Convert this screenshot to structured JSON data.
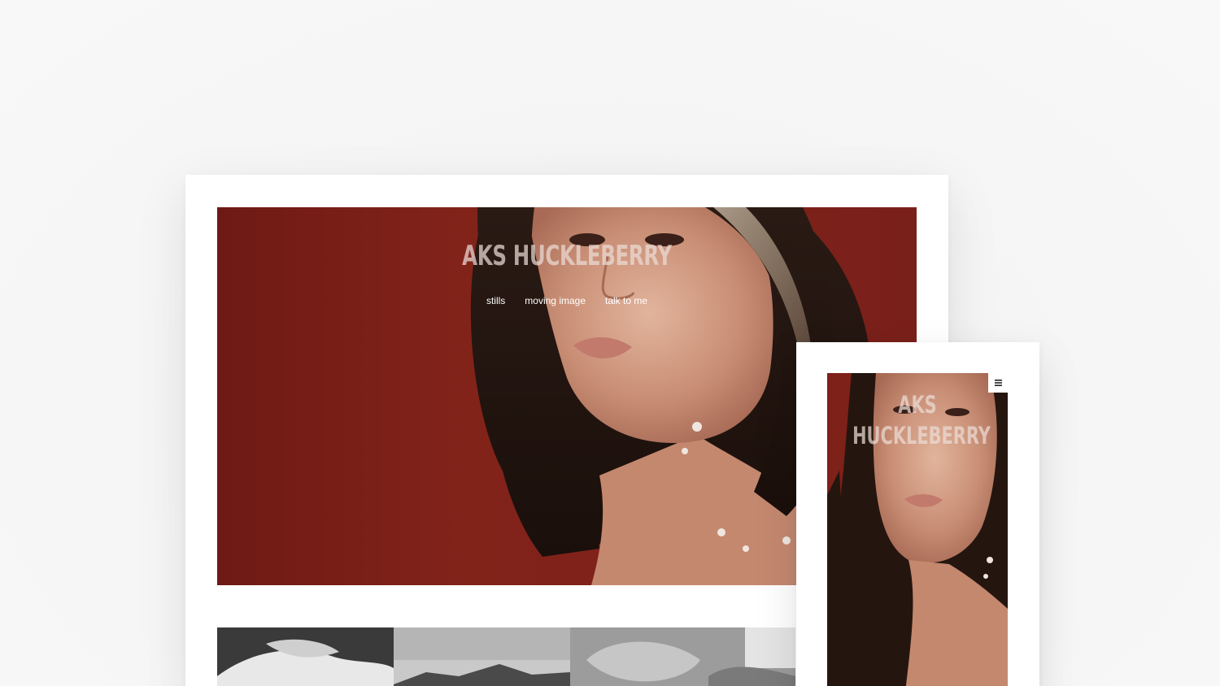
{
  "desktop": {
    "site_title": "AKS HUCKLEBERRY",
    "nav": {
      "items": [
        "stills",
        "moving image",
        "talk to me"
      ]
    }
  },
  "mobile": {
    "site_title_line1": "AKS",
    "site_title_line2": "HUCKLEBERRY",
    "menu_icon": "hamburger-menu-icon"
  },
  "colors": {
    "background": "#f4f4f4",
    "hero_red": "#7e2119",
    "frame": "#ffffff"
  }
}
